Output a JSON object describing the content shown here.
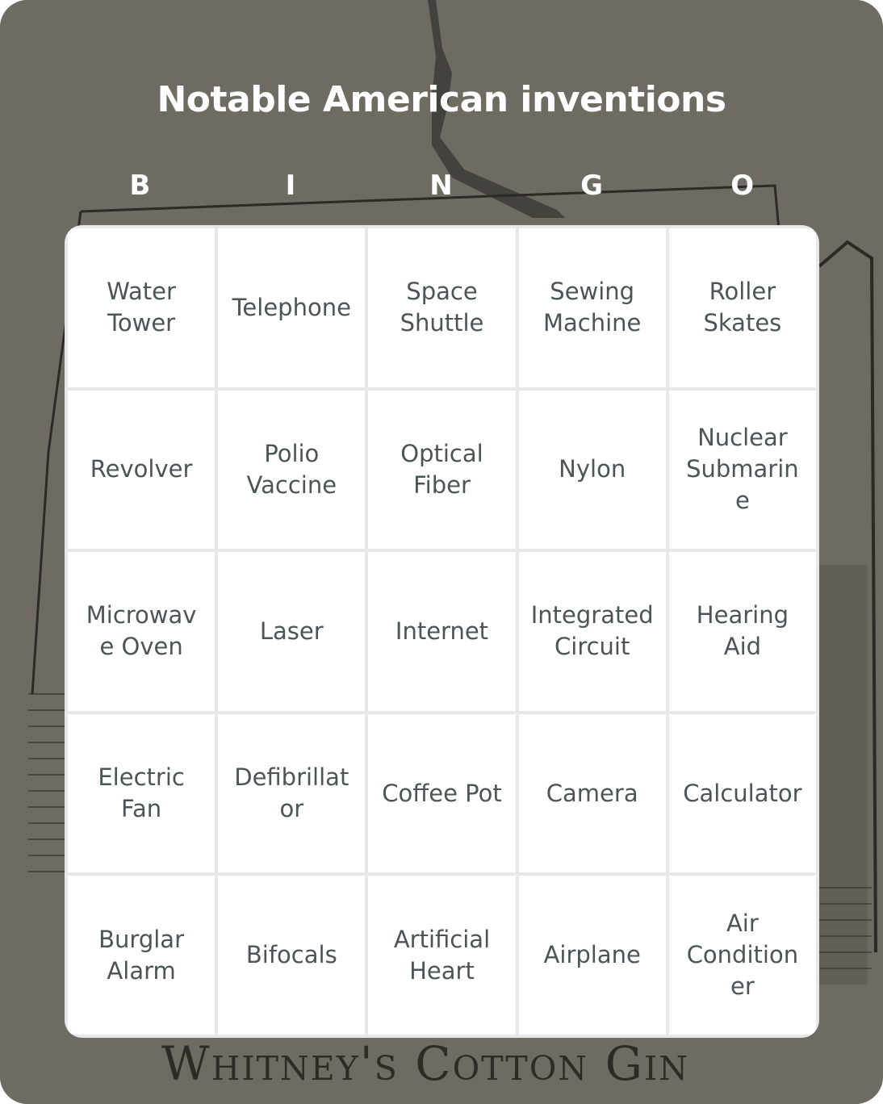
{
  "title": "Notable American inventions",
  "header_letters": [
    "B",
    "I",
    "N",
    "G",
    "O"
  ],
  "cells": [
    [
      "Water Tower",
      "Telephone",
      "Space Shuttle",
      "Sewing Machine",
      "Roller Skates"
    ],
    [
      "Revolver",
      "Polio Vaccine",
      "Optical Fiber",
      "Nylon",
      "Nuclear Submarine"
    ],
    [
      "Microwave Oven",
      "Laser",
      "Internet",
      "Integrated Circuit",
      "Hearing Aid"
    ],
    [
      "Electric Fan",
      "Defibrillator",
      "Coffee Pot",
      "Camera",
      "Calculator"
    ],
    [
      "Burglar Alarm",
      "Bifocals",
      "Artificial Heart",
      "Airplane",
      "Air Conditioner"
    ]
  ],
  "background_caption": "Whitney's Cotton Gin",
  "colors": {
    "background": "#6f6b63",
    "title_text": "#ffffff",
    "cell_text": "#4b5557",
    "grid_lines": "#e6e8e9"
  }
}
